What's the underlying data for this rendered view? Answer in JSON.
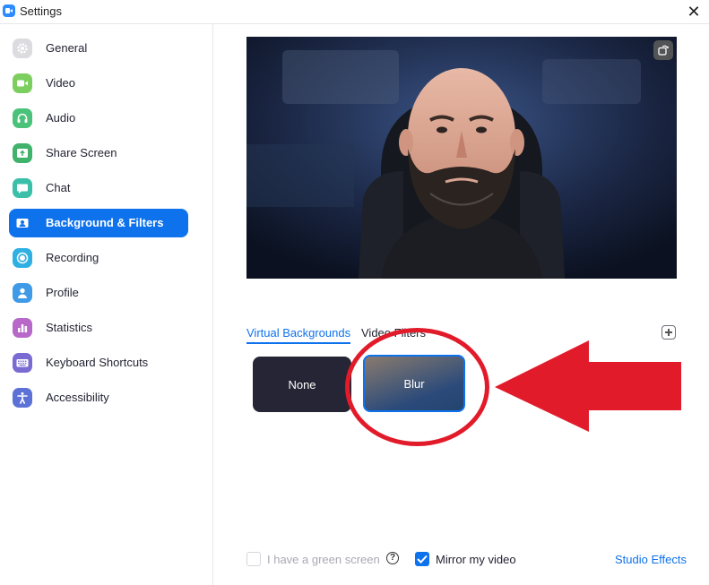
{
  "window": {
    "title": "Settings",
    "close_icon": "close-icon"
  },
  "sidebar": {
    "items": [
      {
        "label": "General",
        "icon": "gear-icon",
        "color": "#d9d9de",
        "active": false
      },
      {
        "label": "Video",
        "icon": "video-camera-icon",
        "color": "#7ccf5f",
        "active": false
      },
      {
        "label": "Audio",
        "icon": "headphones-icon",
        "color": "#4ac27a",
        "active": false
      },
      {
        "label": "Share Screen",
        "icon": "share-screen-icon",
        "color": "#41b26b",
        "active": false
      },
      {
        "label": "Chat",
        "icon": "chat-bubble-icon",
        "color": "#3bbfa8",
        "active": false
      },
      {
        "label": "Background & Filters",
        "icon": "portrait-icon",
        "color": "#0E72ED",
        "active": true
      },
      {
        "label": "Recording",
        "icon": "record-icon",
        "color": "#2fb0e3",
        "active": false
      },
      {
        "label": "Profile",
        "icon": "person-icon",
        "color": "#3f9ae8",
        "active": false
      },
      {
        "label": "Statistics",
        "icon": "bar-chart-icon",
        "color": "#b768c9",
        "active": false
      },
      {
        "label": "Keyboard Shortcuts",
        "icon": "keyboard-icon",
        "color": "#7a6bd3",
        "active": false
      },
      {
        "label": "Accessibility",
        "icon": "accessibility-icon",
        "color": "#5c72d6",
        "active": false
      }
    ]
  },
  "preview": {
    "rotate_icon": "rotate-icon"
  },
  "tabs": [
    {
      "label": "Virtual Backgrounds",
      "active": true
    },
    {
      "label": "Video Filters",
      "active": false
    }
  ],
  "backgrounds": [
    {
      "label": "None",
      "selected": false
    },
    {
      "label": "Blur",
      "selected": true
    }
  ],
  "footer": {
    "green_screen_label": "I have a green screen",
    "green_screen_checked": false,
    "help_icon": "?",
    "mirror_label": "Mirror my video",
    "mirror_checked": true,
    "studio_effects_label": "Studio Effects"
  },
  "colors": {
    "accent": "#0E72ED",
    "annotation_red": "#e21b2a"
  }
}
